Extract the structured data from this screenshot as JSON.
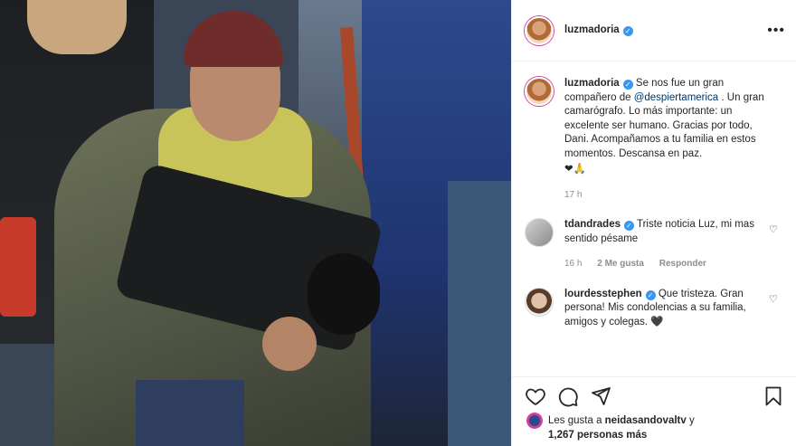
{
  "post": {
    "author": "luzmadoria",
    "more_label": "•••"
  },
  "caption": {
    "username": "luzmadoria",
    "text_before": "Se nos fue un gran compañero de ",
    "mention": "@despiertamerica",
    "text_after": " . Un gran camarógrafo. Lo más importante: un excelente ser humano. Gracias por todo, Dani. Acompañamos a tu familia en estos momentos. Descansa en paz.",
    "emojis": "❤🙏",
    "time": "17 h"
  },
  "comments": [
    {
      "username": "tdandrades",
      "text": "Triste noticia Luz, mi mas sentido pésame",
      "time": "16 h",
      "likes": "2 Me gusta",
      "reply_label": "Responder"
    },
    {
      "username": "lourdesstephen",
      "text": "Que tristeza. Gran persona! Mis condolencias a su familia, amigos y colegas. 🖤"
    }
  ],
  "likes": {
    "line1_prefix": "Les gusta a ",
    "liker": "neidasandovaltv",
    "line1_suffix": " y",
    "line2": "1,267 personas más"
  },
  "colors": {
    "verified": "#3897f0",
    "mention": "#00376b",
    "meta": "#8e8e8e"
  }
}
